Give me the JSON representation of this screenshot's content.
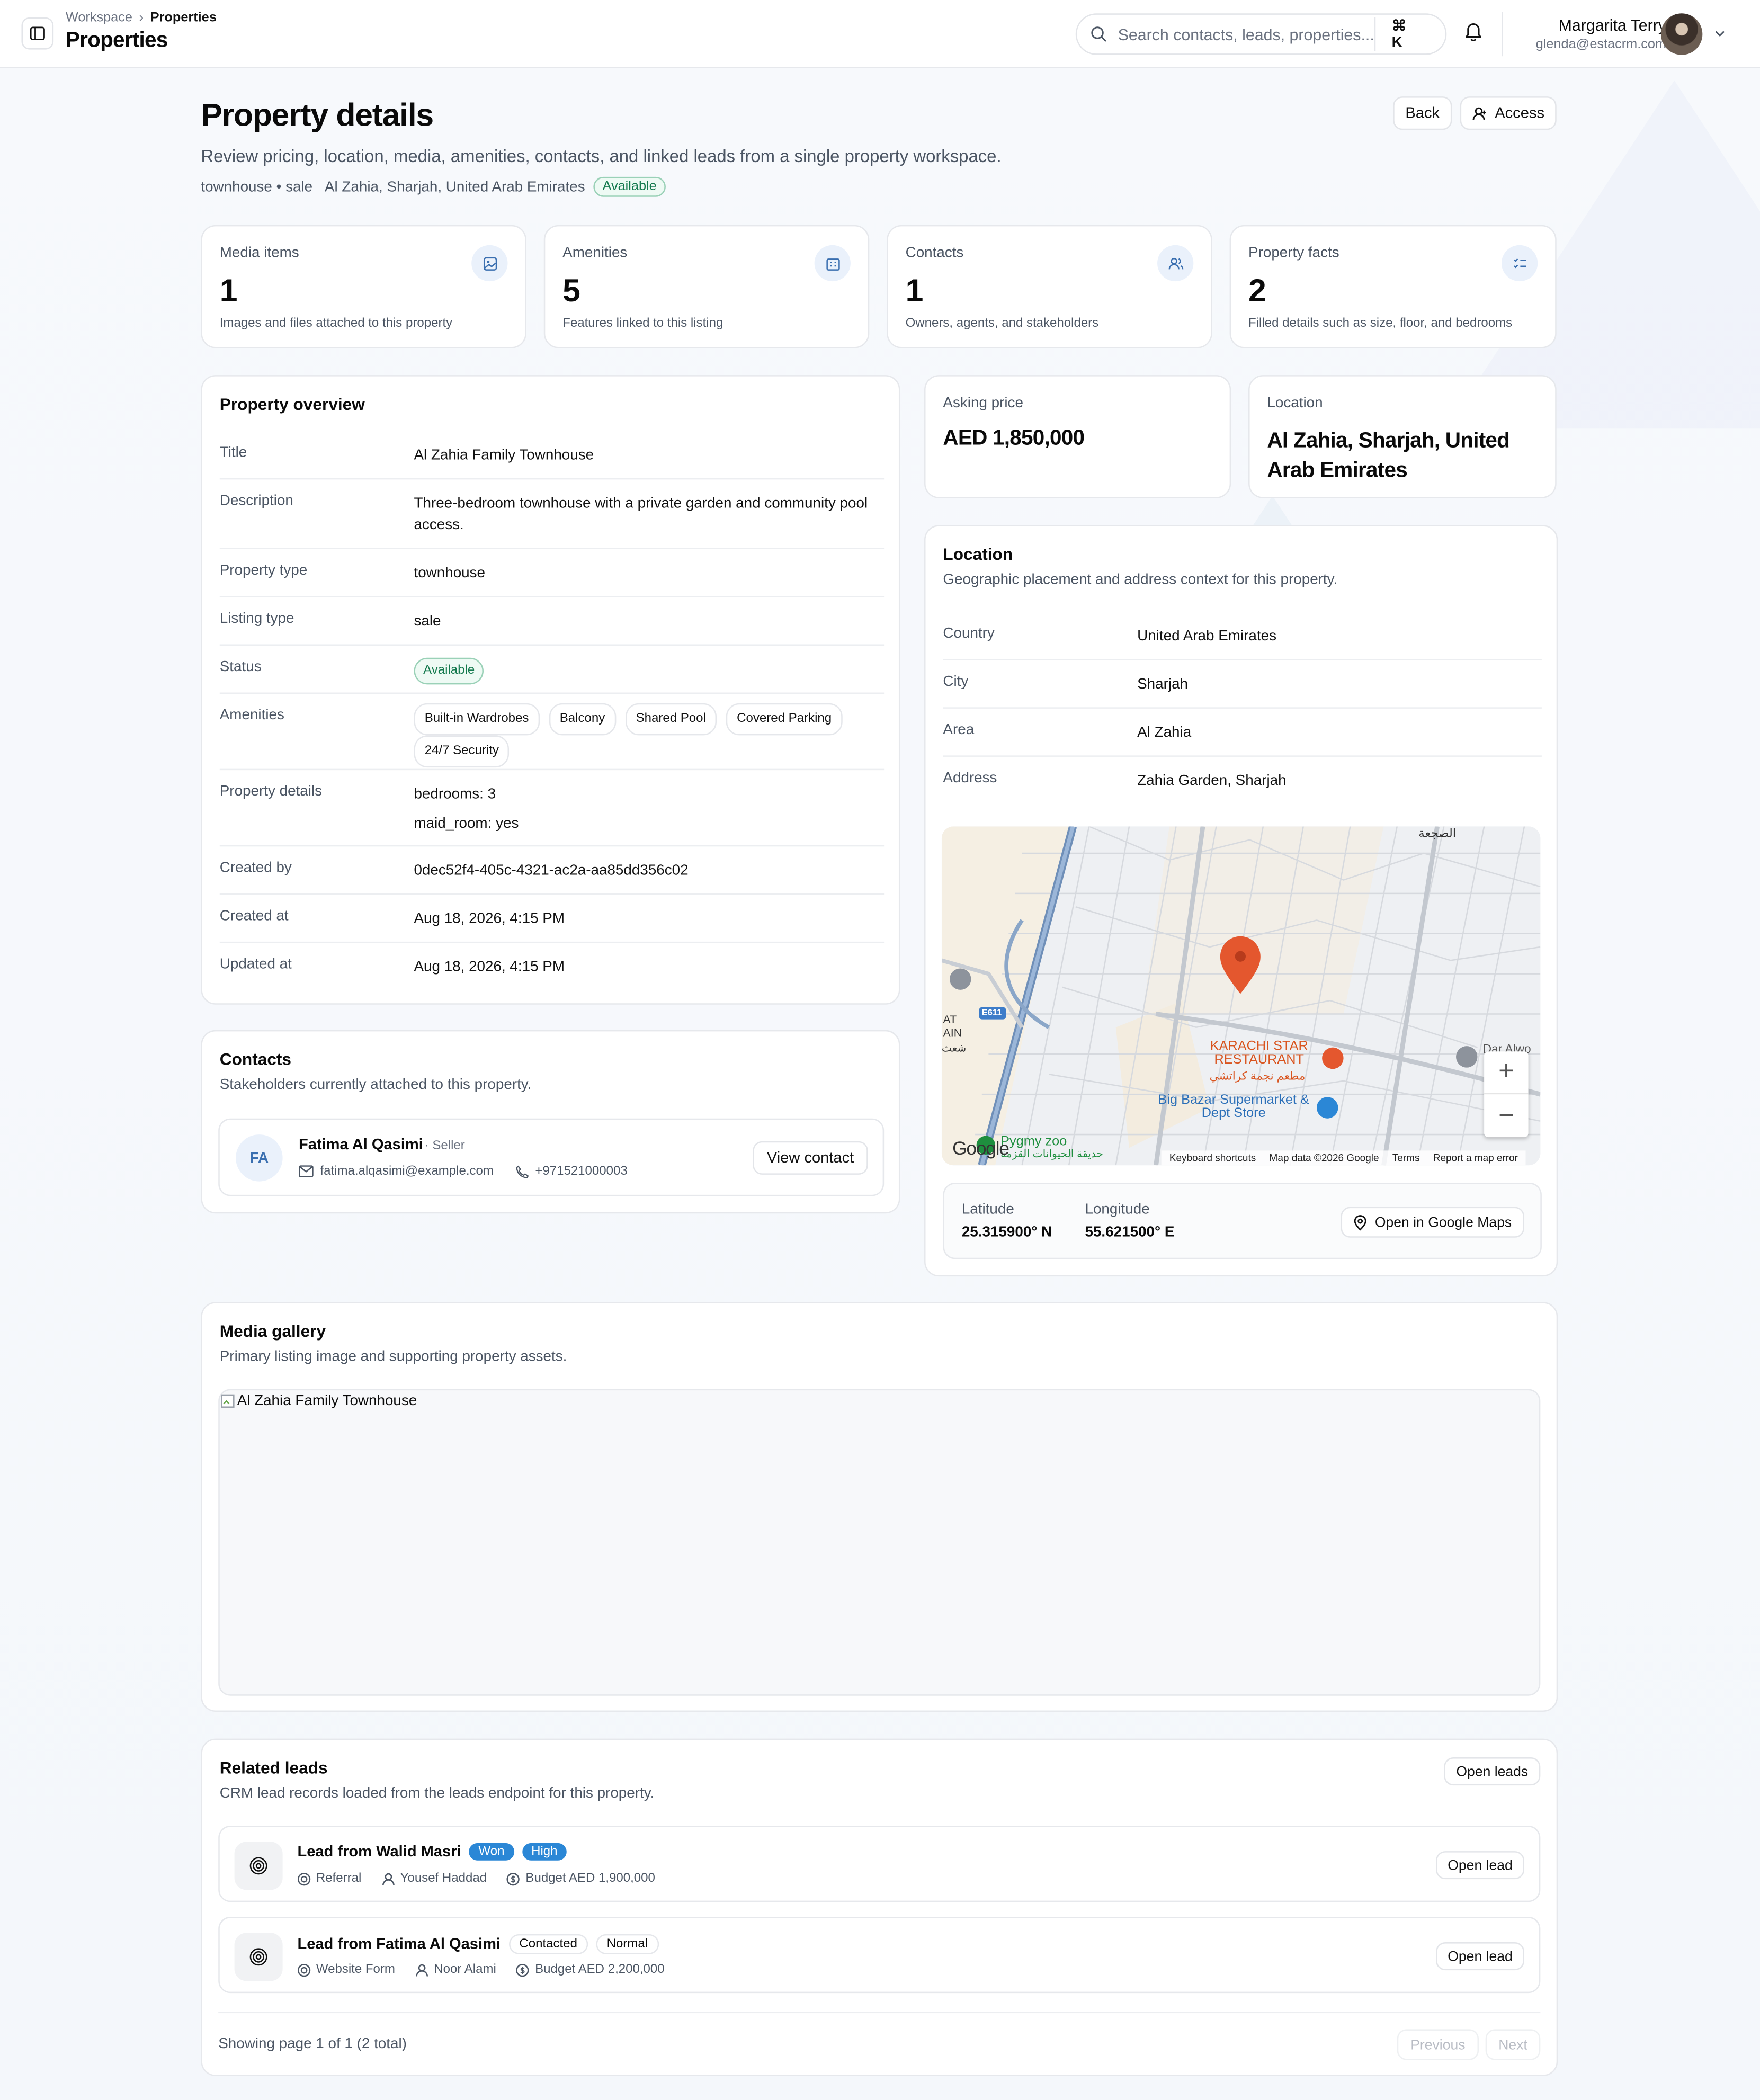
{
  "topbar": {
    "breadcrumb": [
      "Workspace",
      "Properties"
    ],
    "title": "Properties",
    "search_placeholder": "Search contacts, leads, properties...",
    "shortcut": "⌘ K",
    "user_name": "Margarita Terry",
    "user_email": "glenda@estacrm.com"
  },
  "header": {
    "title": "Property details",
    "subtitle": "Review pricing, location, media, amenities, contacts, and linked leads from a single property workspace.",
    "meta_type": "townhouse • sale",
    "meta_location": "Al Zahia, Sharjah, United Arab Emirates",
    "status": "Available",
    "back_label": "Back",
    "access_label": "Access"
  },
  "stats": [
    {
      "label": "Media items",
      "value": "1",
      "desc": "Images and files attached to this property",
      "icon": "image-icon"
    },
    {
      "label": "Amenities",
      "value": "5",
      "desc": "Features linked to this listing",
      "icon": "building-icon"
    },
    {
      "label": "Contacts",
      "value": "1",
      "desc": "Owners, agents, and stakeholders",
      "icon": "users-icon"
    },
    {
      "label": "Property facts",
      "value": "2",
      "desc": "Filled details such as size, floor, and bedrooms",
      "icon": "list-check-icon"
    }
  ],
  "overview": {
    "title": "Property overview",
    "rows": {
      "title_k": "Title",
      "title_v": "Al Zahia Family Townhouse",
      "desc_k": "Description",
      "desc_v": "Three-bedroom townhouse with a private garden and community pool access.",
      "ptype_k": "Property type",
      "ptype_v": "townhouse",
      "ltype_k": "Listing type",
      "ltype_v": "sale",
      "status_k": "Status",
      "status_v": "Available",
      "amen_k": "Amenities",
      "amenities": [
        "Built-in Wardrobes",
        "Balcony",
        "Shared Pool",
        "Covered Parking",
        "24/7 Security"
      ],
      "details_k": "Property details",
      "details": [
        "bedrooms: 3",
        "maid_room: yes"
      ],
      "cby_k": "Created by",
      "cby_v": "0dec52f4-405c-4321-ac2a-aa85dd356c02",
      "cat_k": "Created at",
      "cat_v": "Aug 18, 2026, 4:15 PM",
      "uat_k": "Updated at",
      "uat_v": "Aug 18, 2026, 4:15 PM"
    }
  },
  "price": {
    "label": "Asking price",
    "value": "AED 1,850,000"
  },
  "location_card": {
    "label": "Location",
    "value": "Al Zahia, Sharjah, United Arab Emirates"
  },
  "location": {
    "title": "Location",
    "subtitle": "Geographic placement and address context for this property.",
    "country_k": "Country",
    "country_v": "United Arab Emirates",
    "city_k": "City",
    "city_v": "Sharjah",
    "area_k": "Area",
    "area_v": "Al Zahia",
    "address_k": "Address",
    "address_v": "Zahia Garden, Sharjah",
    "map": {
      "label_restaurant": "KARACHI STAR RESTAURANT",
      "label_restaurant_ar": "مطعم نجمة كراتشي",
      "label_store": "Big Bazar Supermarket & Dept Store",
      "label_zoo": "Pygmy zoo",
      "label_zoo_ar": "حديقة الحيوانات القزمة",
      "label_top": "الصجعة",
      "label_left": "AT AIN",
      "label_left_ar": "شعث",
      "label_right": "Dar Alwo",
      "road": "E611",
      "google": "Google",
      "footer": [
        "Keyboard shortcuts",
        "Map data ©2026 Google",
        "Terms",
        "Report a map error"
      ]
    },
    "lat_label": "Latitude",
    "lat_value": "25.315900° N",
    "lon_label": "Longitude",
    "lon_value": "55.621500° E",
    "open_maps": "Open in Google Maps"
  },
  "contacts": {
    "title": "Contacts",
    "subtitle": "Stakeholders currently attached to this property.",
    "initials": "FA",
    "name": "Fatima Al Qasimi",
    "role": "· Seller",
    "email": "fatima.alqasimi@example.com",
    "phone": "+971521000003",
    "view_label": "View contact"
  },
  "media": {
    "title": "Media gallery",
    "subtitle": "Primary listing image and supporting property assets.",
    "alt": "Al Zahia Family Townhouse"
  },
  "leads": {
    "title": "Related leads",
    "subtitle": "CRM lead records loaded from the leads endpoint for this property.",
    "open_leads": "Open leads",
    "items": [
      {
        "title": "Lead from Walid Masri",
        "status": "Won",
        "priority": "High",
        "source": "Referral",
        "agent": "Yousef Haddad",
        "budget": "Budget AED 1,900,000",
        "open": "Open lead"
      },
      {
        "title": "Lead from Fatima Al Qasimi",
        "status": "Contacted",
        "priority": "Normal",
        "source": "Website Form",
        "agent": "Noor Alami",
        "budget": "Budget AED 2,200,000",
        "open": "Open lead"
      }
    ],
    "pagination": "Showing page 1 of 1 (2 total)",
    "prev": "Previous",
    "next": "Next"
  },
  "colors": {
    "accent": "#2b87d6",
    "pin": "#e4572e",
    "available": "#13794d"
  }
}
